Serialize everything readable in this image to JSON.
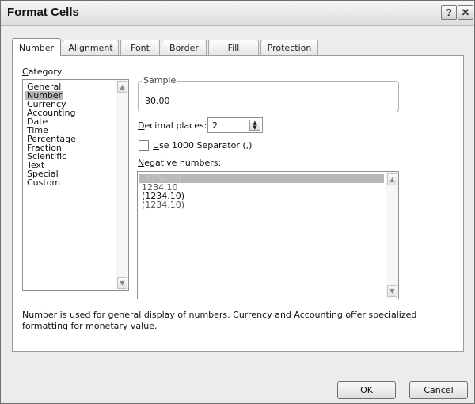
{
  "window": {
    "title": "Format Cells",
    "help_glyph": "?",
    "close_glyph": "✕"
  },
  "tabs": [
    "Number",
    "Alignment",
    "Font",
    "Border",
    "Fill",
    "Protection"
  ],
  "active_tab": "Number",
  "category": {
    "label_prefix": "",
    "label_mnemonic": "C",
    "label_rest": "ategory:",
    "items": [
      "General",
      "Number",
      "Currency",
      "Accounting",
      "Date",
      "Time",
      "Percentage",
      "Fraction",
      "Scientific",
      "Text",
      "Special",
      "Custom"
    ],
    "selected": "Number"
  },
  "sample": {
    "legend": "Sample",
    "value": "30.00"
  },
  "decimal_places": {
    "label_mnemonic": "D",
    "label_rest": "ecimal places:",
    "value": "2"
  },
  "separator": {
    "checked": false,
    "label_mnemonic": "U",
    "label_rest": "se 1000 Separator (,)"
  },
  "negative_numbers": {
    "label_mnemonic": "N",
    "label_rest": "egative numbers:",
    "items": [
      {
        "text": "-1234.10",
        "color": "#c8c8c8",
        "selected": true
      },
      {
        "text": "1234.10",
        "color": "#555555",
        "selected": false
      },
      {
        "text": "(1234.10)",
        "color": "#111111",
        "selected": false
      },
      {
        "text": "(1234.10)",
        "color": "#555555",
        "selected": false
      }
    ]
  },
  "description": "Number is used for general display of numbers.  Currency and Accounting offer specialized formatting for monetary value.",
  "buttons": {
    "ok": "OK",
    "cancel": "Cancel"
  },
  "icons": {
    "scroll_up": "scroll-up-arrow-icon",
    "scroll_down": "scroll-down-arrow-icon",
    "spin": "spin-updown-icon"
  }
}
